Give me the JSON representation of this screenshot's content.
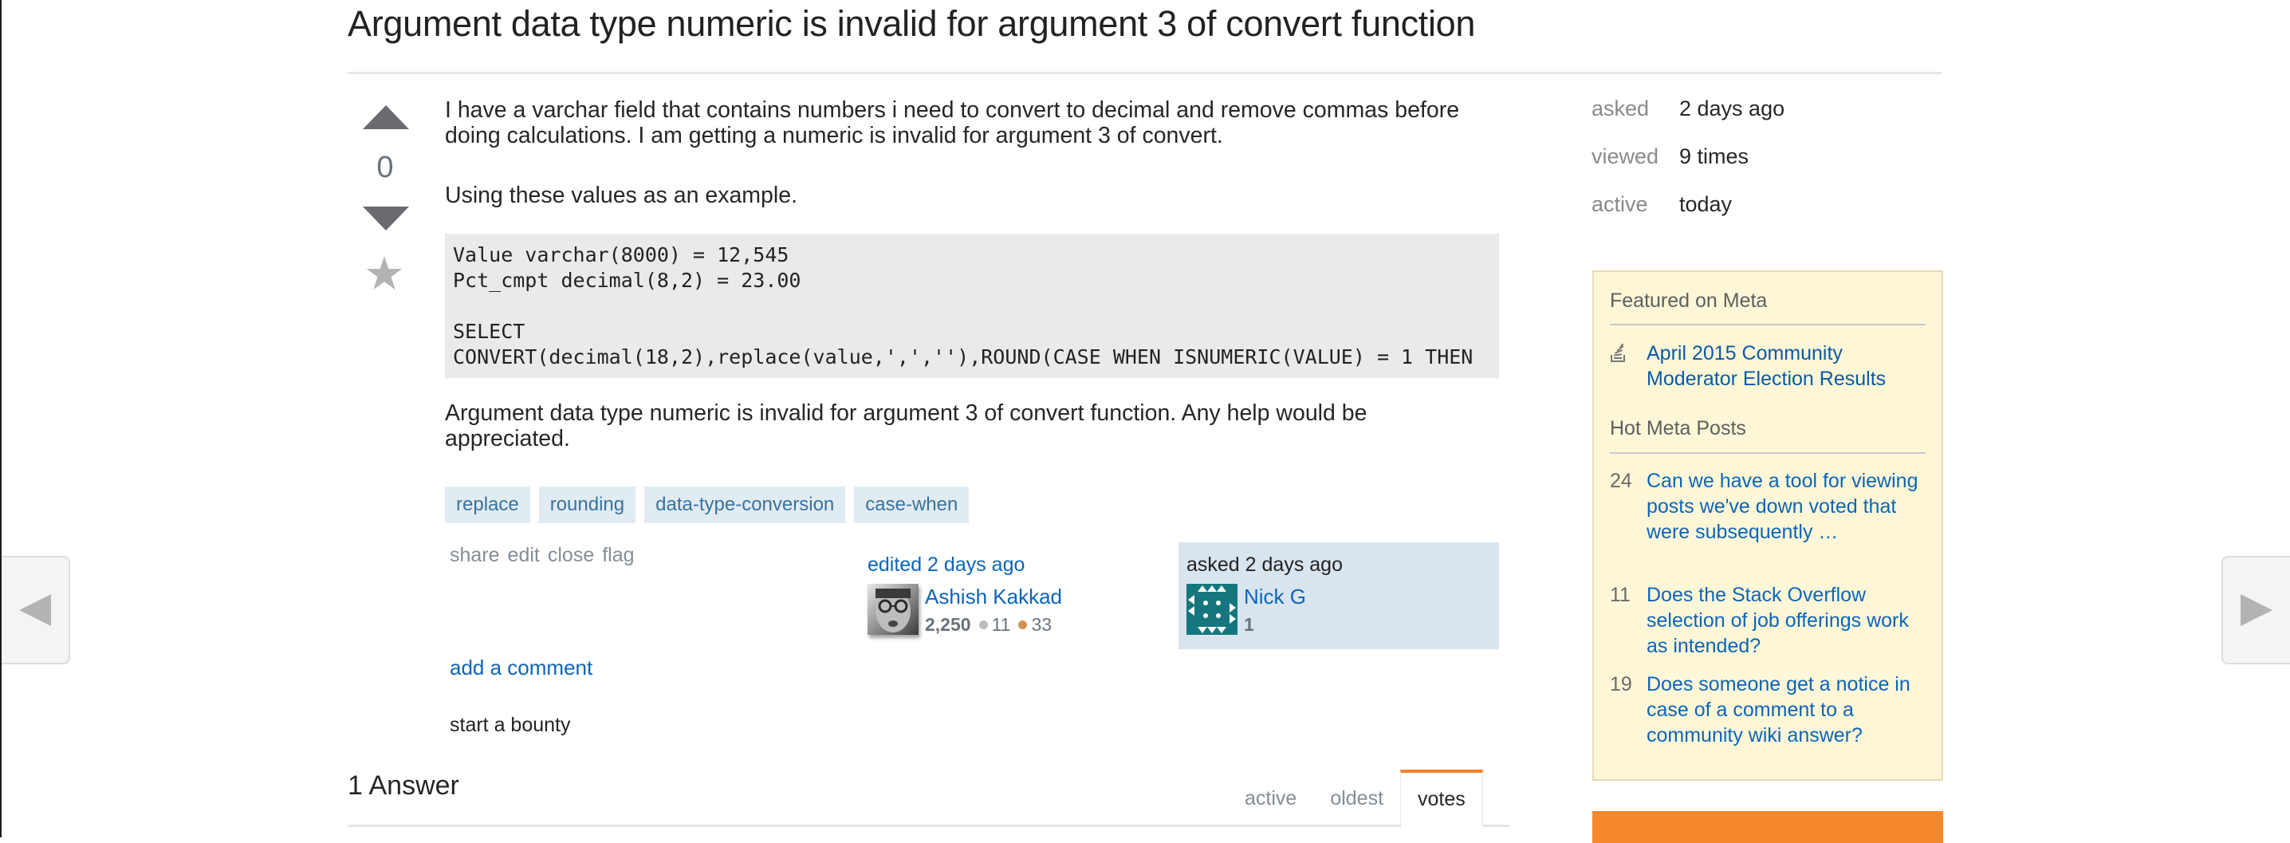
{
  "question": {
    "title": "Argument data type numeric is invalid for argument 3 of convert function",
    "vote_count": "0",
    "body": {
      "paragraph_1": "I have a varchar field that contains numbers i need to convert to decimal and remove commas before doing calculations. I am getting a numeric is invalid for argument 3 of convert.",
      "paragraph_2": "Using these values as an example.",
      "code_lines": [
        "Value varchar(8000) = 12,545",
        "Pct_cmpt decimal(8,2) = 23.00",
        "",
        "SELECT",
        "CONVERT(decimal(18,2),replace(value,',',''),ROUND(CASE WHEN ISNUMERIC(VALUE) = 1 THEN"
      ],
      "paragraph_3": "Argument data type numeric is invalid for argument 3 of convert function. Any help would be appreciated."
    },
    "tags": [
      "replace",
      "rounding",
      "data-type-conversion",
      "case-when"
    ],
    "post_menu": [
      "share",
      "edit",
      "close",
      "flag"
    ],
    "editor": {
      "action": "edited 2 days ago",
      "name": "Ashish Kakkad",
      "reputation": "2,250",
      "silver_badges": "11",
      "bronze_badges": "33"
    },
    "owner": {
      "action": "asked 2 days ago",
      "name": "Nick G",
      "reputation": "1"
    },
    "add_comment": "add a comment",
    "start_bounty": "start a bounty"
  },
  "answers": {
    "header": "1 Answer",
    "sort_tabs": [
      {
        "label": "active",
        "selected": false
      },
      {
        "label": "oldest",
        "selected": false
      },
      {
        "label": "votes",
        "selected": true
      }
    ]
  },
  "sidebar": {
    "stats": [
      {
        "label": "asked",
        "value": "2 days ago"
      },
      {
        "label": "viewed",
        "value": "9 times"
      },
      {
        "label": "active",
        "value": "today"
      }
    ],
    "featured_heading": "Featured on Meta",
    "featured_items": [
      {
        "icon": "stack-overflow-icon",
        "title": "April 2015 Community Moderator Election Results"
      }
    ],
    "hot_heading": "Hot Meta Posts",
    "hot_items": [
      {
        "score": "24",
        "title": "Can we have a tool for viewing posts we've down voted that were subsequently …"
      },
      {
        "score": "11",
        "title": "Does the Stack Overflow selection of job offerings work as intended?"
      },
      {
        "score": "19",
        "title": "Does someone get a notice in case of a comment to a community wiki answer?"
      }
    ]
  },
  "navigation": {
    "prev_icon": "triangle-left-icon",
    "next_icon": "triangle-right-icon"
  },
  "colors": {
    "link": "#0c65b8",
    "tag_bg": "#e1ebf2",
    "tag_text": "#39739d",
    "owner_card_bg": "#d9e5ee",
    "meta_box_bg": "#fdf7d8",
    "accent_orange": "#f48024"
  }
}
